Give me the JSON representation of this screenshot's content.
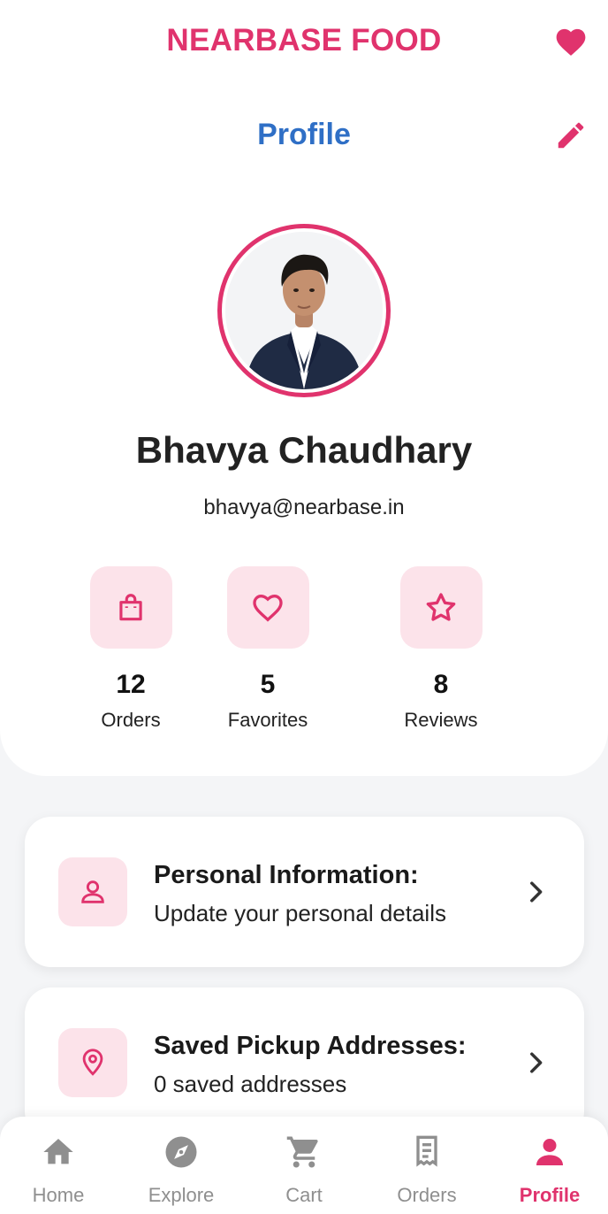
{
  "app": {
    "brand_title": "NEARBASE FOOD"
  },
  "colors": {
    "accent": "#e0336d",
    "title_blue": "#2f6fc6",
    "icon_tint_bg": "#fce3ea",
    "nav_inactive": "#8f8f8f"
  },
  "header": {
    "favorites_icon": "heart-icon"
  },
  "profile": {
    "page_title": "Profile",
    "edit_icon": "pencil-icon",
    "name": "Bhavya Chaudhary",
    "email": "bhavya@nearbase.in",
    "stats": [
      {
        "icon": "shopping-bag-icon",
        "value": "12",
        "label": "Orders"
      },
      {
        "icon": "heart-outline-icon",
        "value": "5",
        "label": "Favorites"
      },
      {
        "icon": "star-outline-icon",
        "value": "8",
        "label": "Reviews"
      }
    ]
  },
  "menu": [
    {
      "icon": "person-icon",
      "title": "Personal Information:",
      "subtitle": "Update your personal details"
    },
    {
      "icon": "location-pin-icon",
      "title": "Saved Pickup Addresses:",
      "subtitle": "0 saved addresses"
    }
  ],
  "bottom_nav": [
    {
      "icon": "home-icon",
      "label": "Home",
      "active": false
    },
    {
      "icon": "compass-icon",
      "label": "Explore",
      "active": false
    },
    {
      "icon": "cart-icon",
      "label": "Cart",
      "active": false
    },
    {
      "icon": "receipt-icon",
      "label": "Orders",
      "active": false
    },
    {
      "icon": "person-icon",
      "label": "Profile",
      "active": true
    }
  ]
}
